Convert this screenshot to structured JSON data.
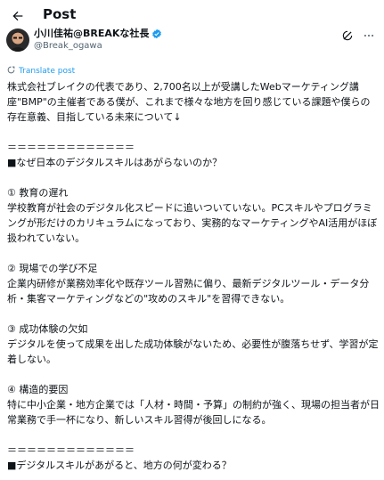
{
  "header": {
    "title": "Post"
  },
  "author": {
    "name": "小川佳祐@BREAKな社長",
    "handle": "@Break_ogawa"
  },
  "translate": {
    "label": "Translate post"
  },
  "post": {
    "text": "株式会社ブレイクの代表であり、2,700名以上が受講したWebマーケティング講座\"BMP\"の主催者である僕が、これまで様々な地方を回り感じている課題や僕らの存在意義、目指している未来について↓\n\n＝＝＝＝＝＝＝＝＝＝＝＝＝\n■なぜ日本のデジタルスキルはあがらないのか？\n\n① 教育の遅れ\n学校教育が社会のデジタル化スピードに追いついていない。PCスキルやプログラミングが形だけのカリキュラムになっており、実務的なマーケティングやAI活用がほぼ扱われていない。\n\n② 現場での学び不足\n企業内研修が業務効率化や既存ツール習熟に偏り、最新デジタルツール・データ分析・集客マーケティングなどの\"攻めのスキル\"を習得できない。\n\n③ 成功体験の欠如\nデジタルを使って成果を出した成功体験がないため、必要性が腹落ちせず、学習が定着しない。\n\n④ 構造的要因\n特に中小企業・地方企業では「人材・時間・予算」の制約が強く、現場の担当者が日常業務で手一杯になり、新しいスキル習得が後回しになる。\n\n＝＝＝＝＝＝＝＝＝＝＝＝＝\n■デジタルスキルがあがると、地方の何が変わる？"
  },
  "colors": {
    "accent": "#1d9bf0",
    "text": "#0f1419",
    "muted": "#536471"
  },
  "icons": [
    "back-arrow-icon",
    "verified-badge-icon",
    "grok-icon",
    "more-icon",
    "translate-icon"
  ]
}
